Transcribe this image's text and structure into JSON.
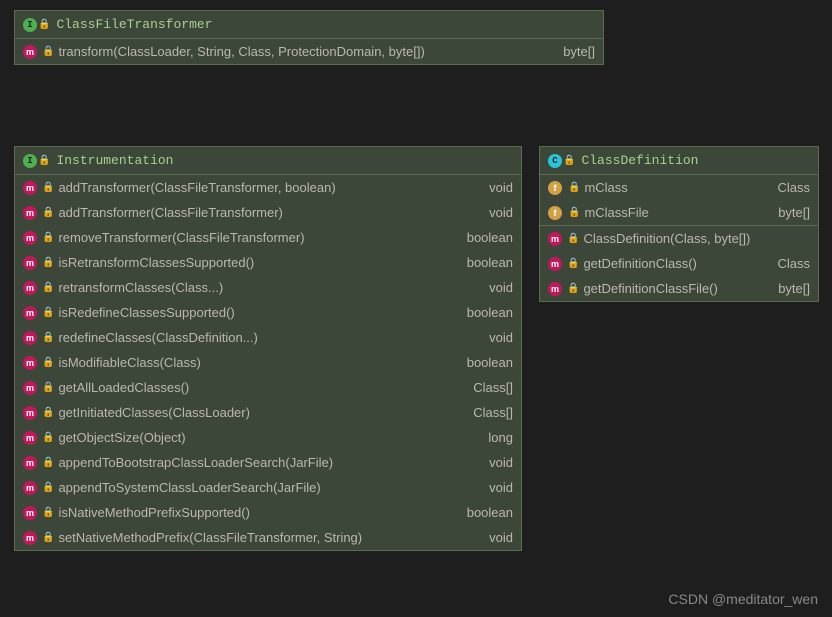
{
  "watermark": "CSDN @meditator_wen",
  "boxes": {
    "box1": {
      "kind": "interface",
      "title": "ClassFileTransformer",
      "sections": [
        [
          {
            "type": "m",
            "sig": "transform(ClassLoader, String, Class<?>, ProtectionDomain, byte[])",
            "ret": "byte[]"
          }
        ]
      ]
    },
    "box2": {
      "kind": "interface",
      "title": "Instrumentation",
      "sections": [
        [
          {
            "type": "m",
            "sig": "addTransformer(ClassFileTransformer, boolean)",
            "ret": "void"
          },
          {
            "type": "m",
            "sig": "addTransformer(ClassFileTransformer)",
            "ret": "void"
          },
          {
            "type": "m",
            "sig": "removeTransformer(ClassFileTransformer)",
            "ret": "boolean"
          },
          {
            "type": "m",
            "sig": "isRetransformClassesSupported()",
            "ret": "boolean"
          },
          {
            "type": "m",
            "sig": "retransformClasses(Class<?>...)",
            "ret": "void"
          },
          {
            "type": "m",
            "sig": "isRedefineClassesSupported()",
            "ret": "boolean"
          },
          {
            "type": "m",
            "sig": "redefineClasses(ClassDefinition...)",
            "ret": "void"
          },
          {
            "type": "m",
            "sig": "isModifiableClass(Class<?>)",
            "ret": "boolean"
          },
          {
            "type": "m",
            "sig": "getAllLoadedClasses()",
            "ret": "Class[]"
          },
          {
            "type": "m",
            "sig": "getInitiatedClasses(ClassLoader)",
            "ret": "Class[]"
          },
          {
            "type": "m",
            "sig": "getObjectSize(Object)",
            "ret": "long"
          },
          {
            "type": "m",
            "sig": "appendToBootstrapClassLoaderSearch(JarFile)",
            "ret": "void"
          },
          {
            "type": "m",
            "sig": "appendToSystemClassLoaderSearch(JarFile)",
            "ret": "void"
          },
          {
            "type": "m",
            "sig": "isNativeMethodPrefixSupported()",
            "ret": "boolean"
          },
          {
            "type": "m",
            "sig": "setNativeMethodPrefix(ClassFileTransformer, String)",
            "ret": "void"
          }
        ]
      ]
    },
    "box3": {
      "kind": "class",
      "title": "ClassDefinition",
      "sections": [
        [
          {
            "type": "f",
            "locked": true,
            "sig": "mClass",
            "ret": "Class<?>"
          },
          {
            "type": "f",
            "locked": true,
            "sig": "mClassFile",
            "ret": "byte[]"
          }
        ],
        [
          {
            "type": "m",
            "sig": "ClassDefinition(Class<?>, byte[])",
            "ret": ""
          },
          {
            "type": "m",
            "sig": "getDefinitionClass()",
            "ret": "Class<?>"
          },
          {
            "type": "m",
            "sig": "getDefinitionClassFile()",
            "ret": "byte[]"
          }
        ]
      ]
    }
  }
}
